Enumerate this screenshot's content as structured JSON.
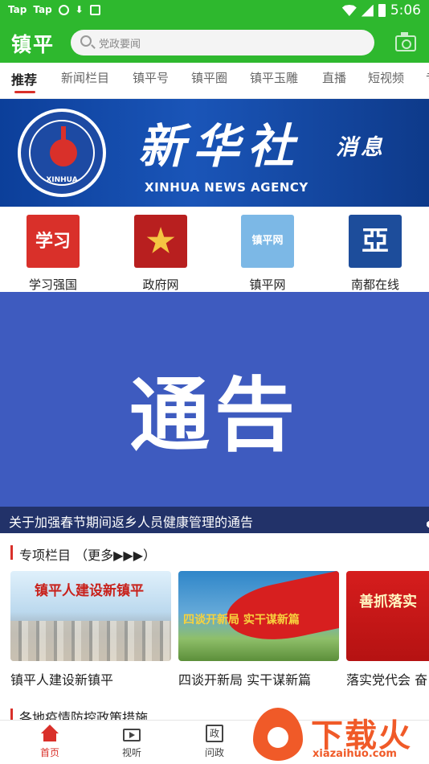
{
  "status_bar": {
    "left_icons": [
      "taptap-icon",
      "taptap-icon",
      "sync-icon",
      "download-icon",
      "app-icon"
    ],
    "left_labels": [
      "Tap",
      "Tap"
    ],
    "time": "5:06"
  },
  "header": {
    "brand": "镇平",
    "search_placeholder": "党政要闻"
  },
  "tabs": [
    {
      "label": "推荐",
      "active": true
    },
    {
      "label": "新闻栏目"
    },
    {
      "label": "镇平号"
    },
    {
      "label": "镇平圈"
    },
    {
      "label": "镇平玉雕"
    },
    {
      "label": "直播"
    },
    {
      "label": "短视频"
    },
    {
      "label": "专"
    }
  ],
  "xinhua_banner": {
    "chinese_name": "新华社",
    "message": "消息",
    "english_name": "XINHUA NEWS AGENCY",
    "emblem_text": "XINHUA"
  },
  "quick_links": [
    {
      "label": "学习强国",
      "glyph": "学习",
      "bg": "#d9302a",
      "fg": "#ffffff"
    },
    {
      "label": "政府网",
      "glyph": "★",
      "bg": "#b81f1f",
      "fg": "#f5c542"
    },
    {
      "label": "镇平网",
      "glyph": "镇平网",
      "bg": "#7cb8e6",
      "fg": "#ffffff"
    },
    {
      "label": "南都在线",
      "glyph": "亞",
      "bg": "#1d4d9b",
      "fg": "#ffffff"
    }
  ],
  "notice_slider": {
    "big_text": "通告",
    "caption": "关于加强春节期间返乡人员健康管理的通告",
    "dot_count": 9,
    "active_dot": 0
  },
  "special_section": {
    "title": "专项栏目 （更多▶▶▶）",
    "cards": [
      {
        "title": "镇平人建设新镇平",
        "thumb_text": "镇平人建设新镇平"
      },
      {
        "title": "四谈开新局 实干谋新篇",
        "thumb_text": "四谈开新局 实干谋新篇"
      },
      {
        "title": "落实党代会 奋",
        "thumb_text": "善抓落实"
      }
    ]
  },
  "next_section": {
    "title": "各地疫情防控政策措施"
  },
  "bottom_nav": [
    {
      "label": "首页",
      "active": true
    },
    {
      "label": "视听"
    },
    {
      "label": "问政"
    }
  ],
  "watermark": {
    "text": "下载火",
    "url": "xiazaihuo.com"
  },
  "colors": {
    "brand_green": "#2eb82e",
    "accent_red": "#d9302a",
    "notice_blue": "#3e5bbf"
  }
}
